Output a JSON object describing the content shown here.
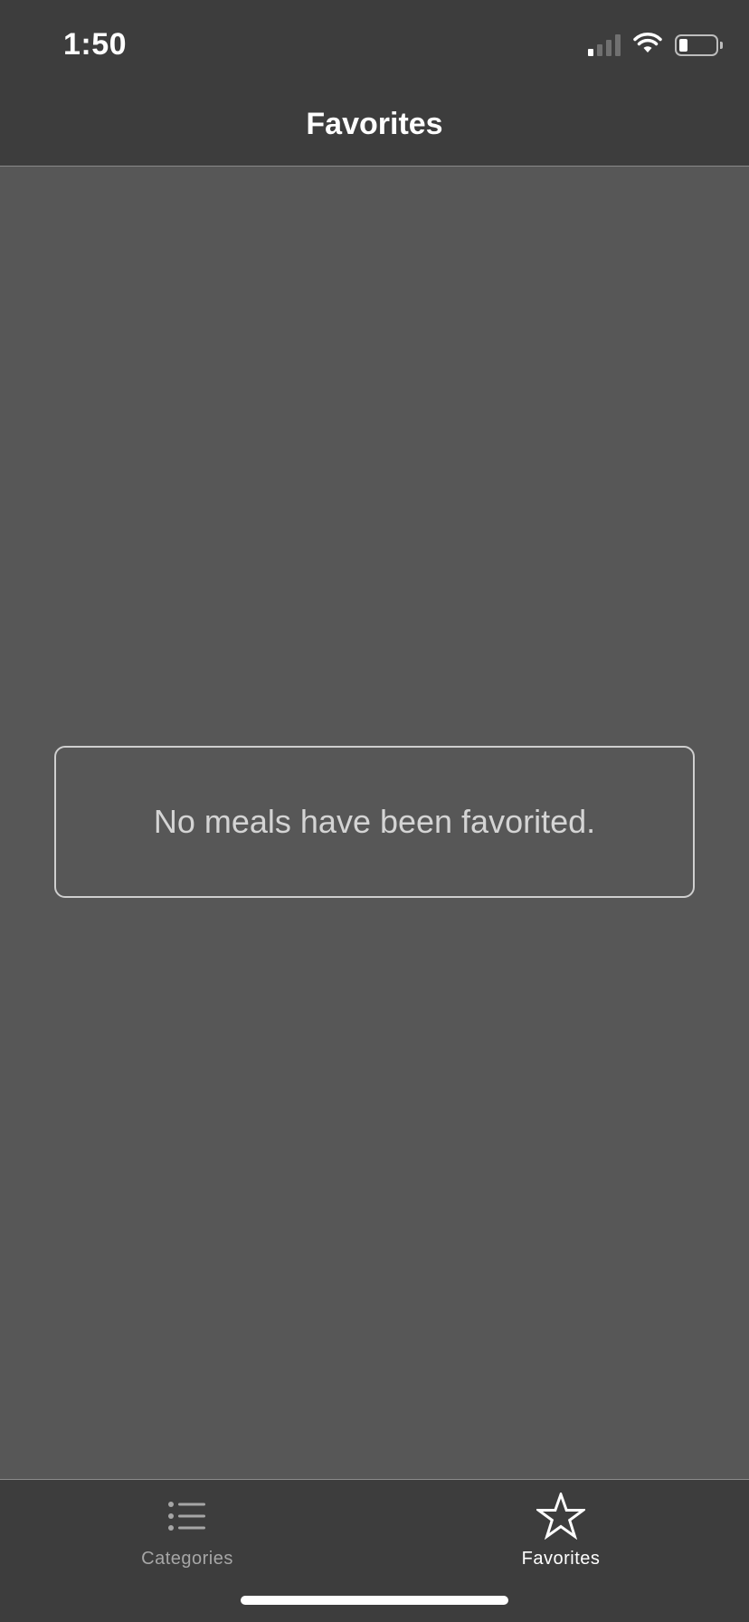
{
  "status_bar": {
    "time": "1:50",
    "icons": [
      "cellular-signal-icon",
      "wifi-icon",
      "battery-icon"
    ]
  },
  "nav": {
    "title": "Favorites"
  },
  "empty_state": {
    "message": "No meals have been favorited."
  },
  "tab_bar": {
    "tabs": [
      {
        "label": "Categories",
        "icon": "list-icon",
        "selected": false
      },
      {
        "label": "Favorites",
        "icon": "star-icon",
        "selected": true
      }
    ]
  },
  "colors": {
    "bar_background": "#3d3d3d",
    "content_background": "#575757",
    "active_tab": "#ffffff",
    "inactive_tab": "#a6a6a6"
  }
}
